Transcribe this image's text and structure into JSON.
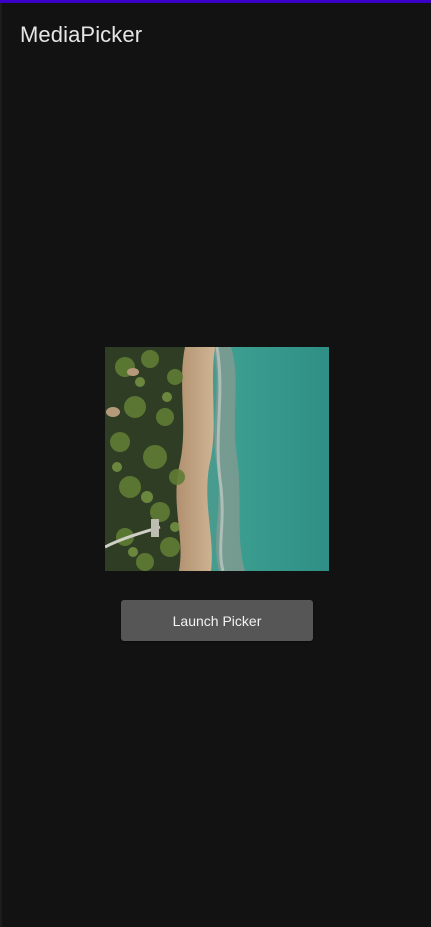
{
  "app_bar": {
    "title": "MediaPicker"
  },
  "preview": {
    "image_semantic": "aerial-beach-photo"
  },
  "launch_button": {
    "label": "Launch Picker"
  },
  "colors": {
    "background": "#121212",
    "status_strip": "#3a00c8",
    "button": "#565656",
    "title_text": "#e6e6e6"
  }
}
